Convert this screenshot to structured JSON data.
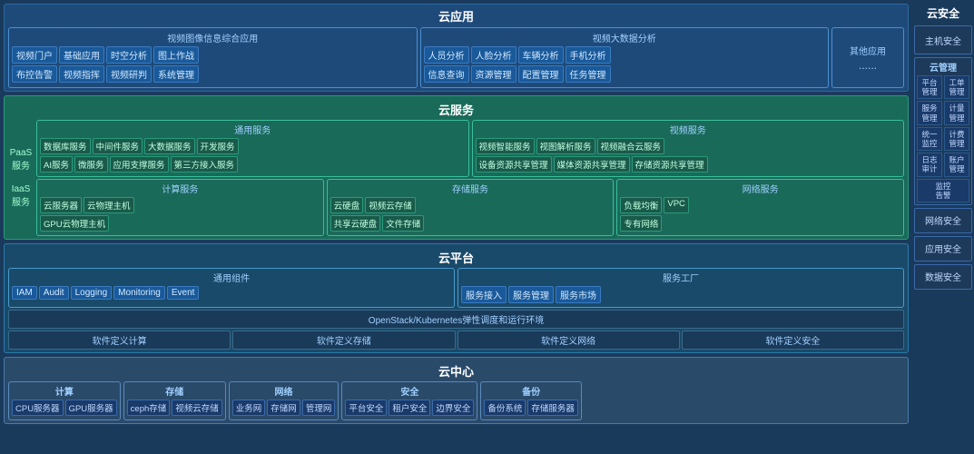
{
  "sections": {
    "cloudApp": {
      "title": "云应用",
      "videoImage": {
        "title": "视频图像信息综合应用",
        "row1": [
          "视频门户",
          "基础应用",
          "时空分析",
          "图上作战"
        ],
        "row2": [
          "布控告警",
          "视频指挥",
          "视频研判",
          "系统管理"
        ]
      },
      "videoBigData": {
        "title": "视频大数据分析",
        "row1": [
          "人员分析",
          "人脸分析",
          "车辆分析",
          "手机分析"
        ],
        "row2": [
          "信息查询",
          "资源管理",
          "配置管理",
          "任务管理"
        ]
      },
      "otherApps": {
        "title": "其他应用",
        "content": "......"
      }
    },
    "cloudService": {
      "title": "云服务",
      "paas": {
        "label": "PaaS\n服务",
        "general": {
          "title": "通用服务",
          "row1": [
            "数据库服务",
            "中间件服务",
            "大数据服务",
            "开发服务"
          ],
          "row2": [
            "AI服务",
            "微服务",
            "应用支撑服务",
            "第三方接入服务"
          ]
        },
        "video": {
          "title": "视频服务",
          "row1": [
            "视频智能服务",
            "视图解析服务",
            "视频融合云服务"
          ],
          "row2": [
            "设备资源共享管理",
            "媒体资源共享管理",
            "存储资源共享管理"
          ]
        }
      },
      "iaas": {
        "label": "IaaS\n服务",
        "compute": {
          "title": "计算服务",
          "row1": [
            "云服务器",
            "云物理主机"
          ],
          "row2": [
            "GPU云物理主机"
          ]
        },
        "storage": {
          "title": "存储服务",
          "row1": [
            "云硬盘"
          ],
          "row2": [
            "共享云硬盘"
          ],
          "row3": [
            "视频云存储",
            "文件存储"
          ]
        },
        "network": {
          "title": "网络服务",
          "row1": [
            "负载均衡",
            "VPC"
          ],
          "row2": [
            "专有网络"
          ]
        }
      }
    },
    "cloudPlatform": {
      "title": "云平台",
      "general": {
        "title": "通用组件",
        "items": [
          "IAM",
          "Audit",
          "Logging",
          "Monitoring",
          "Event"
        ]
      },
      "factory": {
        "title": "服务工厂",
        "items": [
          "服务接入",
          "服务管理",
          "服务市场"
        ]
      },
      "openstack": "OpenStack/Kubernetes弹性调度和运行环境",
      "sdn": [
        "软件定义计算",
        "软件定义存储",
        "软件定义网络",
        "软件定义安全"
      ]
    },
    "cloudCenter": {
      "title": "云中心",
      "groups": [
        {
          "title": "计算",
          "items": [
            "CPU服务器",
            "GPU服务器"
          ]
        },
        {
          "title": "存储",
          "items": [
            "ceph存储",
            "视频云存储"
          ]
        },
        {
          "title": "网络",
          "items": [
            "业务网",
            "存储网",
            "管理网"
          ]
        },
        {
          "title": "安全",
          "items": [
            "平台安全",
            "租户安全",
            "边界安全"
          ]
        },
        {
          "title": "备份",
          "items": [
            "备份系统",
            "存储服务器"
          ]
        }
      ]
    }
  },
  "rightSidebar": {
    "mainTitle": "云安全",
    "blocks": [
      {
        "title": "主机\n安全",
        "single": true
      },
      {
        "title": "云管理",
        "rows": [
          [
            "平台\n管理",
            "工单\n管理"
          ],
          [
            "服务\n管理",
            "计量\n管理"
          ],
          [
            "统一\n监控",
            "计费\n管理"
          ],
          [
            "日志\n审计",
            "账户\n管理"
          ],
          [
            "监控\n告警",
            ""
          ]
        ]
      },
      {
        "title": "网络\n安全",
        "single": true
      },
      {
        "title": "应用\n安全",
        "single": true
      },
      {
        "title": "数据\n安全",
        "single": true
      }
    ]
  }
}
